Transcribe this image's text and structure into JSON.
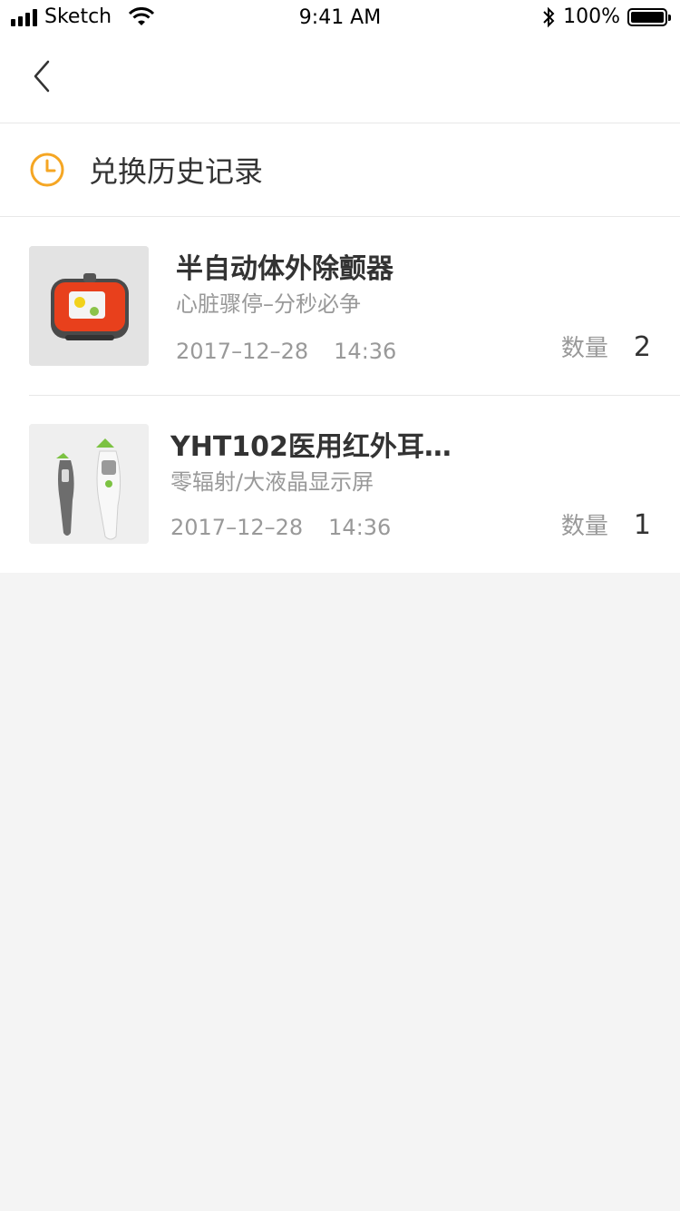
{
  "status_bar": {
    "carrier": "Sketch",
    "time": "9:41 AM",
    "battery": "100%"
  },
  "nav": {
    "back_icon": "chevron-left-icon"
  },
  "section": {
    "icon": "clock-icon",
    "title": "兑换历史记录"
  },
  "items": [
    {
      "name": "半自动体外除颤器",
      "desc": "心脏骤停–分秒必争",
      "date": "2017–12–28",
      "time": "14:36",
      "qty_label": "数量",
      "qty": "2"
    },
    {
      "name": "YHT102医用红外耳…",
      "desc": "零辐射/大液晶显示屏",
      "date": "2017–12–28",
      "time": "14:36",
      "qty_label": "数量",
      "qty": "1"
    }
  ],
  "colors": {
    "accent": "#f5a623",
    "background": "#f4f4f4",
    "secondary_text": "#999999"
  }
}
